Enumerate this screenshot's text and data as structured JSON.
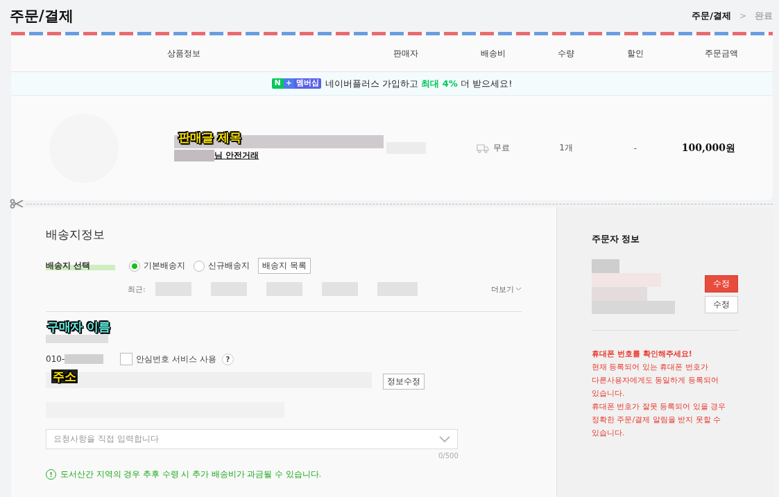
{
  "page": {
    "title": "주문/결제",
    "steps": [
      {
        "label": "주문/결제",
        "selected": true
      },
      {
        "label": "완료",
        "selected": false
      }
    ],
    "step_separator": ">"
  },
  "table": {
    "columns": [
      "상품정보",
      "판매자",
      "배송비",
      "수량",
      "할인",
      "주문금액"
    ]
  },
  "promo": {
    "badge_letter": "N",
    "badge_plus": "+",
    "badge_text": "멤버십",
    "text": "네이버플러스 가입하고 **최대 4%** 더 받으세요!"
  },
  "item": {
    "title_annotation": "판매글 제목",
    "seller_suffix": "님 안전거래",
    "shipping": "무료",
    "quantity": "1개",
    "discount": "-",
    "price": "100,000원"
  },
  "shipping_info": {
    "heading": "배송지정보",
    "select_label": "배송지 선택",
    "options": [
      {
        "label": "기본배송지",
        "selected": true
      },
      {
        "label": "신규배송지",
        "selected": false
      }
    ],
    "list_button": "배송지 목록",
    "recent_label": "최근:",
    "more": "더보기",
    "name_annotation": "구매자 이름",
    "phone_prefix": "010-",
    "safe_number": {
      "label": "안심번호 서비스 사용",
      "checked": false
    },
    "help": "?",
    "address_annotation": "주소",
    "edit_button": "정보수정",
    "request_placeholder": "요청사항을 직접 입력합니다",
    "counter": "0/500",
    "notice_icon": "!",
    "notice": "도서산간 지역의 경우 추후 수령 시 추가 배송비가 과금될 수 있습니다."
  },
  "orderer": {
    "heading": "주문자 정보",
    "buttons": [
      {
        "label": "수정",
        "kind": "primary"
      },
      {
        "label": "수정",
        "kind": "secondary"
      }
    ],
    "warning_title": "휴대폰 번호를 확인해주세요!",
    "warning_lines": [
      "현재 등록되어 있는 휴대폰 번호가",
      "다른사용자에게도 동일하게 등록되어",
      "있습니다.",
      "휴대폰 번호가 잘못 등록되어 있을 경우",
      "정확한 주문/결제 알림을 받지 못할 수",
      "있습니다."
    ]
  }
}
